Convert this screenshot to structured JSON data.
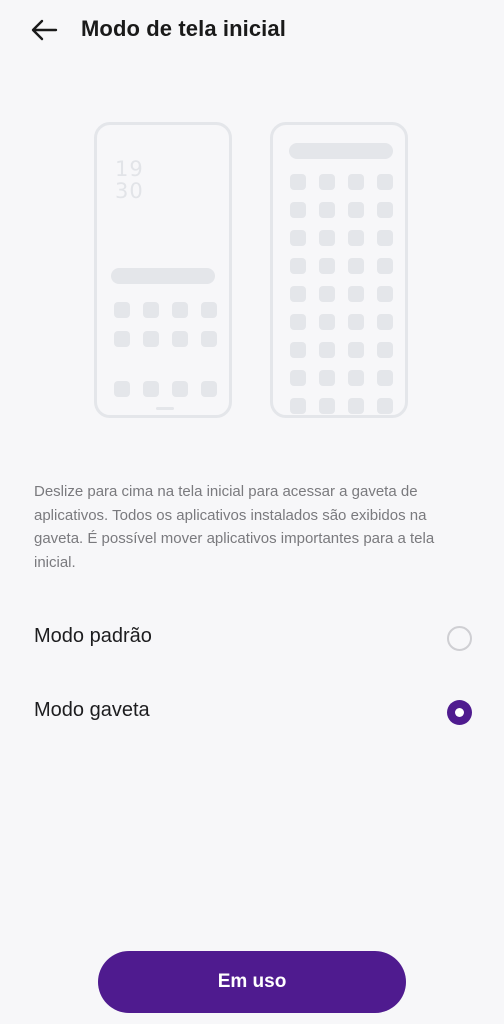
{
  "header": {
    "title": "Modo de tela inicial",
    "back_icon": "arrow-left-icon"
  },
  "illustration": {
    "left_phone": {
      "clock_hour": "19",
      "clock_minute": "30"
    }
  },
  "description": "Deslize para cima na tela inicial para acessar a gaveta de aplicativos. Todos os aplicativos instalados são exibidos na gaveta. É possível mover aplicativos importantes para a tela inicial.",
  "options": [
    {
      "label": "Modo padrão",
      "selected": false
    },
    {
      "label": "Modo gaveta",
      "selected": true
    }
  ],
  "action_button": {
    "label": "Em uso"
  },
  "colors": {
    "accent": "#4f1b8f",
    "background": "#f7f7f9",
    "illustration_gray": "#e4e6ea",
    "description_text": "#7a7a7e"
  }
}
